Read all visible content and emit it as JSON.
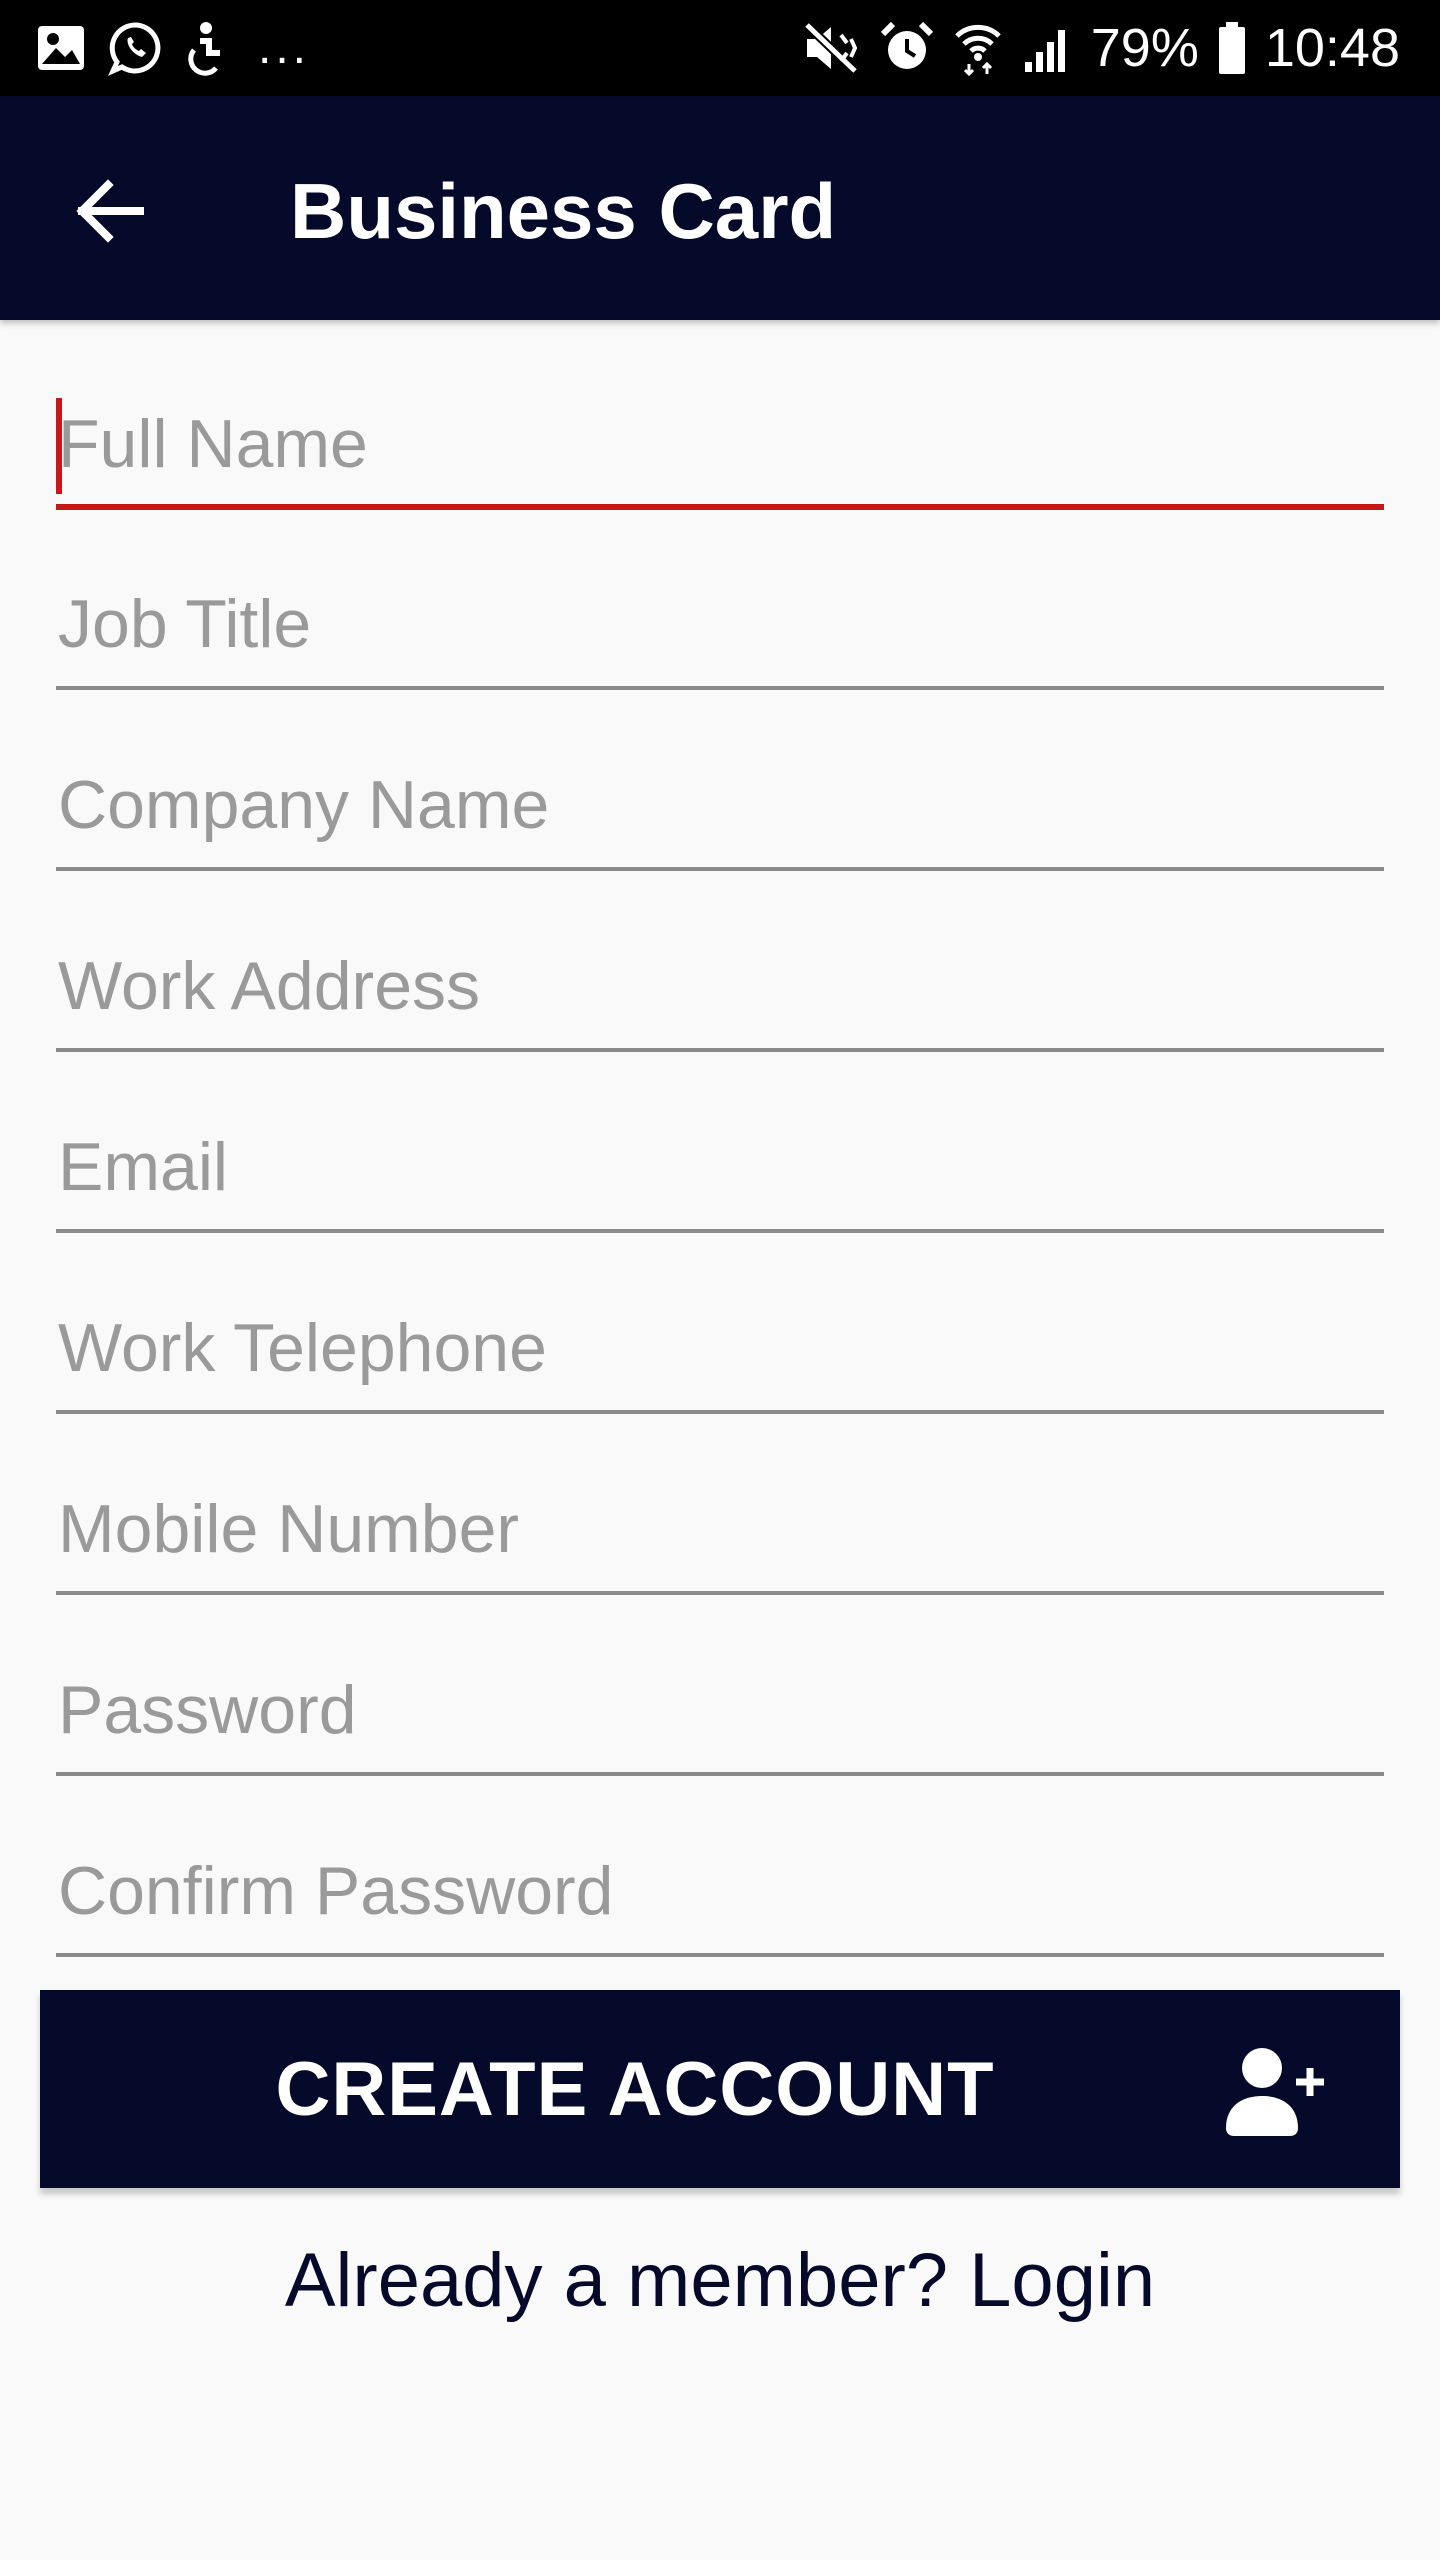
{
  "status_bar": {
    "icons_left": [
      "gallery-icon",
      "whatsapp-icon",
      "accessibility-icon"
    ],
    "more_indicator": "...",
    "icons_right": [
      "mute-icon",
      "alarm-icon",
      "wifi-icon",
      "signal-icon"
    ],
    "battery_percent": "79%",
    "time": "10:48"
  },
  "app_bar": {
    "title": "Business Card",
    "back_icon": "arrow-left-icon"
  },
  "form": {
    "fields": [
      {
        "name": "full-name-field",
        "placeholder": "Full Name",
        "value": "",
        "focused": true
      },
      {
        "name": "job-title-field",
        "placeholder": "Job Title",
        "value": ""
      },
      {
        "name": "company-name-field",
        "placeholder": "Company Name",
        "value": ""
      },
      {
        "name": "work-address-field",
        "placeholder": "Work Address",
        "value": ""
      },
      {
        "name": "email-field",
        "placeholder": "Email",
        "value": ""
      },
      {
        "name": "work-telephone-field",
        "placeholder": "Work Telephone",
        "value": ""
      },
      {
        "name": "mobile-number-field",
        "placeholder": "Mobile Number",
        "value": ""
      },
      {
        "name": "password-field",
        "placeholder": "Password",
        "value": ""
      },
      {
        "name": "confirm-password-field",
        "placeholder": "Confirm Password",
        "value": ""
      }
    ]
  },
  "create_button": {
    "label": "CREATE ACCOUNT",
    "icon": "add-user-icon"
  },
  "login_link": {
    "text": "Already a member? Login"
  },
  "colors": {
    "primary_dark": "#060a2a",
    "accent_red": "#c8161d",
    "placeholder_gray": "#9a9a9a",
    "background": "#f9f9f9"
  }
}
